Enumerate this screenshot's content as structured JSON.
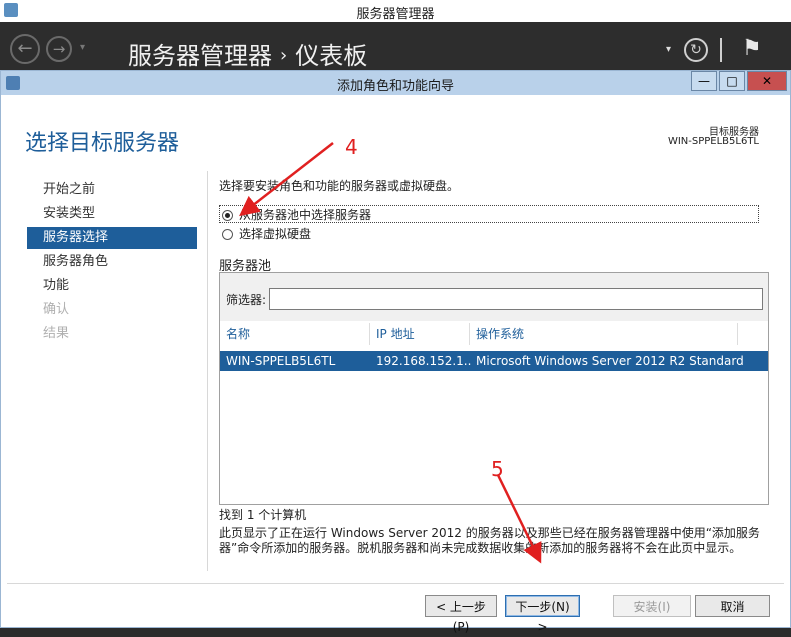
{
  "outer_window": {
    "title": "服务器管理器"
  },
  "server_manager": {
    "breadcrumb_root": "服务器管理器",
    "breadcrumb_sep": "›",
    "breadcrumb_page": "仪表板",
    "back_glyph": "←",
    "forward_glyph": "→",
    "dropdown_glyph": "▾",
    "refresh_glyph": "↻",
    "flag_glyph": "⚑"
  },
  "wizard": {
    "title": "添加角色和功能向导",
    "min_glyph": "—",
    "max_glyph": "□",
    "close_glyph": "✕",
    "page_title": "选择目标服务器",
    "target_server_label": "目标服务器",
    "target_server_value": "WIN-SPPELB5L6TL",
    "steps": [
      {
        "label": "开始之前",
        "state": "normal"
      },
      {
        "label": "安装类型",
        "state": "normal"
      },
      {
        "label": "服务器选择",
        "state": "active"
      },
      {
        "label": "服务器角色",
        "state": "normal"
      },
      {
        "label": "功能",
        "state": "normal"
      },
      {
        "label": "确认",
        "state": "disabled"
      },
      {
        "label": "结果",
        "state": "disabled"
      }
    ],
    "description": "选择要安装角色和功能的服务器或虚拟硬盘。",
    "radio_pool_label": "从服务器池中选择服务器",
    "radio_vhd_label": "选择虚拟硬盘",
    "pool_title": "服务器池",
    "filter_label": "筛选器:",
    "filter_value": "",
    "columns": {
      "name": "名称",
      "ip": "IP 地址",
      "os": "操作系统"
    },
    "rows": [
      {
        "name": "WIN-SPPELB5L6TL",
        "ip": "192.168.152.1...",
        "os": "Microsoft Windows Server 2012 R2 Standard"
      }
    ],
    "found_text": "找到 1 个计算机",
    "note": "此页显示了正在运行 Windows Server 2012 的服务器以及那些已经在服务器管理器中使用“添加服务器”命令所添加的服务器。脱机服务器和尚未完成数据收集的新添加的服务器将不会在此页中显示。",
    "buttons": {
      "prev": "< 上一步(P)",
      "next": "下一步(N) >",
      "install": "安装(I)",
      "cancel": "取消"
    }
  },
  "annotations": {
    "label_4": "4",
    "label_5": "5",
    "color": "#e02020"
  }
}
